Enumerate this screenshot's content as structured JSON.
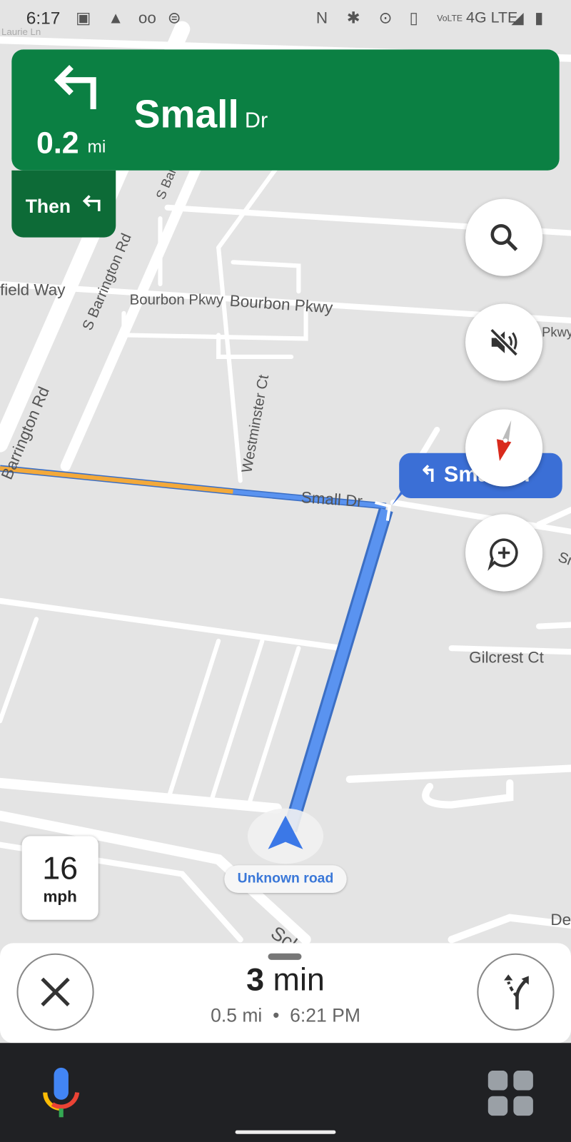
{
  "status_bar": {
    "time": "6:17",
    "network": "4G LTE",
    "icons": [
      "image-icon",
      "navigation-icon",
      "voicemail-icon",
      "steering-wheel-icon",
      "nfc-icon",
      "bluetooth-icon",
      "location-icon",
      "vibrate-icon",
      "volte-icon",
      "signal-icon",
      "battery-icon"
    ]
  },
  "maneuver": {
    "distance": "0.2",
    "unit": "mi",
    "street": "Small",
    "street_suffix": "Dr",
    "icon": "turn-left-icon",
    "then_label": "Then",
    "then_icon": "turn-left-icon",
    "color": "#0b8043"
  },
  "map": {
    "labels": [
      "Laurie Ln",
      "S Barrington Rd",
      "S Barrington Rd",
      "field Way",
      "Bourbon Pkwy",
      "Bourbon Pkwy",
      "Barrington Rd",
      "Westminster Ct",
      "Small Dr",
      "Gilcrest Ct",
      "Sch",
      "De",
      "Pkwy",
      "Sm"
    ],
    "callout": "Small Dr",
    "route_color": "#5a93f0",
    "traffic_color": "#f3a93a"
  },
  "controls": {
    "search": "search-icon",
    "mute": "volume-off-icon",
    "compass": "compass-icon",
    "report": "add-report-icon"
  },
  "speed": {
    "value": "16",
    "unit": "mph"
  },
  "current_road": "Unknown road",
  "trip": {
    "duration_value": "3",
    "duration_unit": "min",
    "distance": "0.5 mi",
    "separator": "•",
    "arrival": "6:21 PM"
  },
  "bottom_nav": {
    "mic": "google-mic-icon",
    "apps": "apps-grid-icon"
  }
}
